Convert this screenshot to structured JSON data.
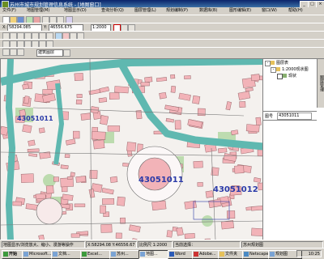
{
  "window": {
    "title": "苏州市城市规划管理信息系统 - [地图窗口]"
  },
  "menus": [
    "文件(F)",
    "地图管理(M)",
    "地图显示(D)",
    "查询分析(Q)",
    "图层管理(L)",
    "规划编制(P)",
    "数据库(B)",
    "图形编辑(E)",
    "窗口(W)",
    "帮助(H)"
  ],
  "coords": {
    "x_value": "58294.085",
    "y_value": "46556.675",
    "scale_value": "1:2000",
    "x_label": "X:",
    "y_label": "Y:"
  },
  "toolbar": {
    "layer_select_value": "建筑图层"
  },
  "map": {
    "labels": [
      {
        "text": "43051011",
        "size": "small"
      },
      {
        "text": "43051011",
        "size": "large"
      },
      {
        "text": "43051012",
        "size": "large"
      }
    ],
    "road_color": "#5fb8b0",
    "building_color": "#f2b3b8",
    "green_color": "#b7d9a8"
  },
  "tree": {
    "root": "图层表",
    "child1": "1:2000现状图",
    "child2": "现状"
  },
  "attribute": {
    "label": "图号",
    "value": "43051011"
  },
  "side_tab": "图层管理",
  "status": {
    "left": "地图显示/浏览放大、缩小、漫游等操作",
    "coords": "X:58294.08 Y:46556.67",
    "scale": "比例尺 1:2000",
    "right": "当前选择：",
    "layer": "苏州规划图"
  },
  "taskbar": {
    "start": "开始",
    "items": [
      "Microsoft...",
      "文档...",
      "Excel...",
      "苏州...",
      "地图...",
      "Word",
      "Adobe...",
      "文件夹",
      "Netscape",
      "规划图"
    ],
    "clock": "10:25"
  }
}
